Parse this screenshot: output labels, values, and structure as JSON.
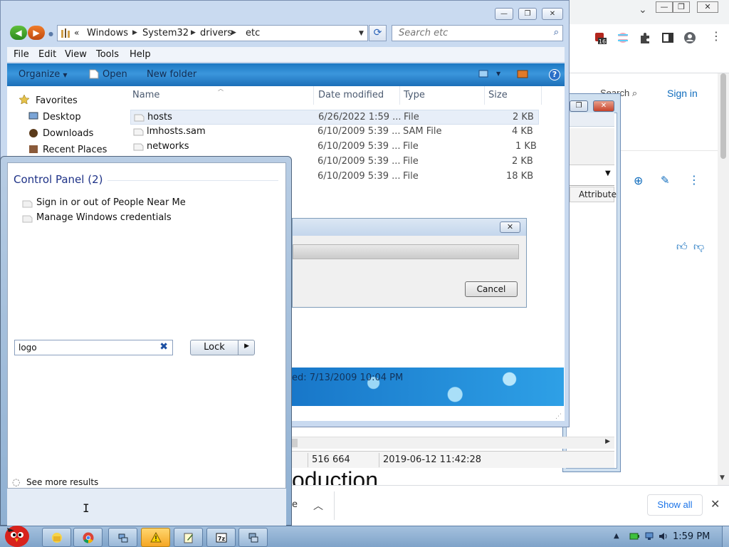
{
  "browser": {
    "search_label": "Search",
    "signin_label": "Sign in",
    "attribute_header": "Attribute",
    "intro_text": "oduction",
    "download_partial": "e",
    "show_all": "Show all",
    "extension_badge": "16"
  },
  "explorer": {
    "breadcrumb": [
      "Windows",
      "System32",
      "drivers",
      "etc"
    ],
    "breadcrumb_prefix": "«",
    "search_placeholder": "Search etc",
    "menu": [
      "File",
      "Edit",
      "View",
      "Tools",
      "Help"
    ],
    "commands": {
      "organize": "Organize",
      "open": "Open",
      "new_folder": "New folder"
    },
    "nav": [
      "Favorites",
      "Desktop",
      "Downloads",
      "Recent Places"
    ],
    "columns": [
      "Name",
      "Date modified",
      "Type",
      "Size"
    ],
    "files": [
      {
        "name": "hosts",
        "date": "6/26/2022 1:59 ...",
        "type": "File",
        "size": "2 KB"
      },
      {
        "name": "lmhosts.sam",
        "date": "6/10/2009 5:39 ...",
        "type": "SAM File",
        "size": "4 KB"
      },
      {
        "name": "networks",
        "date": "6/10/2009 5:39 ...",
        "type": "File",
        "size": "1 KB"
      },
      {
        "name": "",
        "date": "6/10/2009 5:39 ...",
        "type": "File",
        "size": "2 KB"
      },
      {
        "name": "",
        "date": "6/10/2009 5:39 ...",
        "type": "File",
        "size": "18 KB"
      }
    ],
    "details_text": "ed: 7/13/2009 10:04 PM"
  },
  "status": {
    "size": "516 664",
    "date": "2019-06-12 11:42:28"
  },
  "dialog": {
    "cancel": "Cancel"
  },
  "startmenu": {
    "heading": "Control Panel (2)",
    "results": [
      "Sign in or out of People Near Me",
      "Manage Windows credentials"
    ],
    "see_more": "See more results",
    "search_value": "logo",
    "lock": "Lock"
  },
  "taskbar": {
    "clock": "1:59 PM"
  },
  "colors": {
    "cmdbar": "#1c78c2",
    "accent_link": "#0f6cbd",
    "start_heading": "#1e3287"
  }
}
